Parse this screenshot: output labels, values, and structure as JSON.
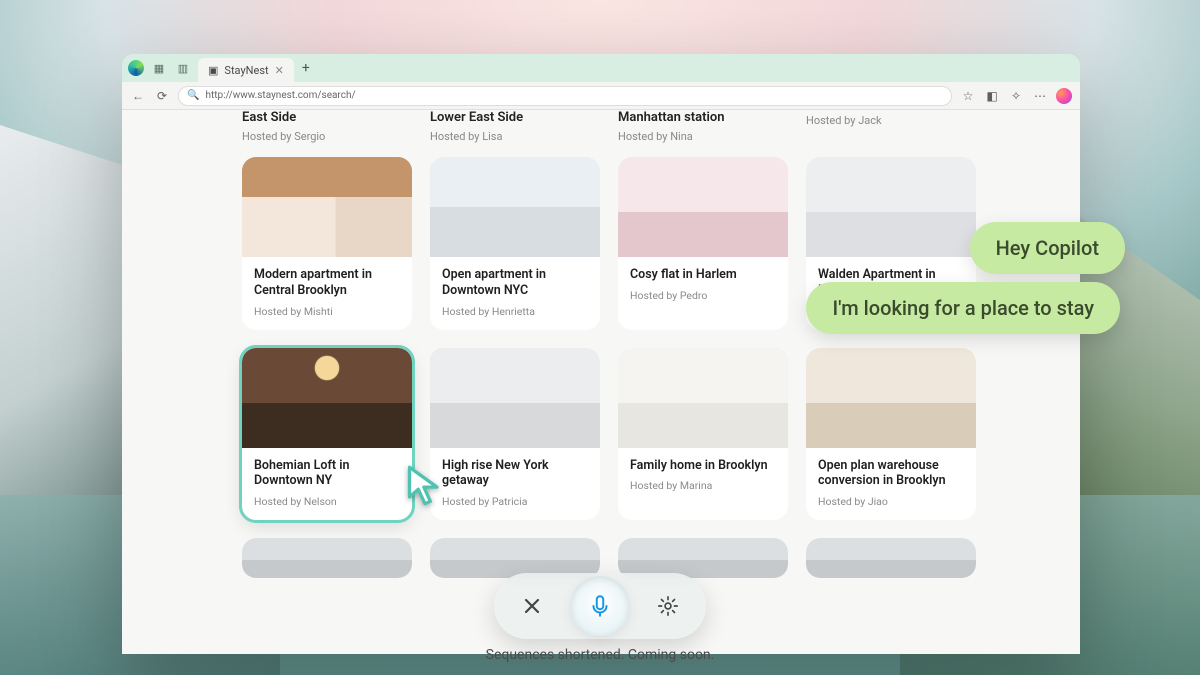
{
  "browser": {
    "tab_title": "StayNest",
    "url": "http://www.staynest.com/search/"
  },
  "stubs": [
    {
      "title": "East Side",
      "host": "Hosted by Sergio"
    },
    {
      "title": "Lower East Side",
      "host": "Hosted by Lisa"
    },
    {
      "title": "Manhattan station",
      "host": "Hosted by Nina"
    },
    {
      "title": "",
      "host": "Hosted by Jack"
    }
  ],
  "cards": [
    {
      "title": "Modern apartment in Central Brooklyn",
      "host": "Hosted by Mishti",
      "thumb": "room-a",
      "selected": false
    },
    {
      "title": "Open apartment in Downtown NYC",
      "host": "Hosted by Henrietta",
      "thumb": "room-b",
      "selected": false
    },
    {
      "title": "Cosy flat in Harlem",
      "host": "Hosted by Pedro",
      "thumb": "room-c",
      "selected": false
    },
    {
      "title": "Walden Apartment in Manhattan",
      "host": "Hosted by ",
      "thumb": "room-d",
      "selected": false
    },
    {
      "title": "Bohemian Loft in Downtown NY",
      "host": "Hosted by Nelson",
      "thumb": "room-e",
      "selected": true
    },
    {
      "title": "High rise New York getaway",
      "host": "Hosted by Patricia",
      "thumb": "room-f",
      "selected": false
    },
    {
      "title": "Family home in Brooklyn",
      "host": "Hosted by Marina",
      "thumb": "room-g",
      "selected": false
    },
    {
      "title": "Open plan warehouse conversion in Brooklyn",
      "host": "Hosted by Jiao",
      "thumb": "room-h",
      "selected": false
    }
  ],
  "copilot": {
    "bubble1": "Hey Copilot",
    "bubble2": "I'm looking for a place to stay"
  },
  "caption": "Sequences shortened. Coming soon."
}
